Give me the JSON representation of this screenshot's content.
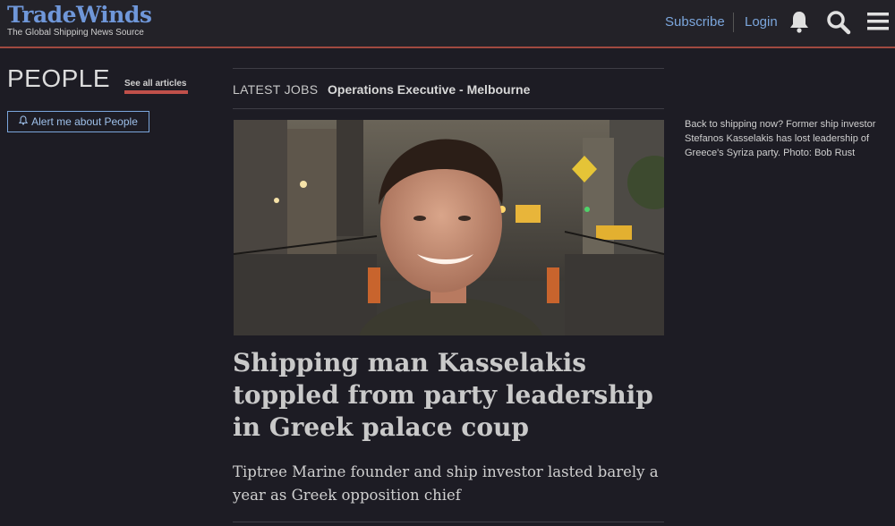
{
  "header": {
    "logo_text": "TradeWinds",
    "tagline": "The Global Shipping News Source",
    "subscribe_label": "Subscribe",
    "login_label": "Login",
    "icons": [
      "bell-icon",
      "search-icon",
      "menu-icon"
    ]
  },
  "section": {
    "title": "PEOPLE",
    "see_all_label": "See all articles",
    "alert_label": "Alert me about People"
  },
  "jobs": {
    "label": "LATEST JOBS",
    "title": "Operations Executive - Melbourne"
  },
  "article": {
    "headline": "Shipping man Kasselakis toppled from party leadership in Greek palace coup",
    "standfirst": "Tiptree Marine founder and ship investor lasted barely a year as Greek opposition chief",
    "caption": "Back to shipping now? Former ship investor Stefanos Kasselakis has lost leadership of Greece's Syriza party. Photo: Bob Rust"
  },
  "colors": {
    "background": "#1d1c24",
    "accent_link": "#7ba6dc",
    "header_rule": "#a04a40",
    "underline": "#c0504a"
  }
}
